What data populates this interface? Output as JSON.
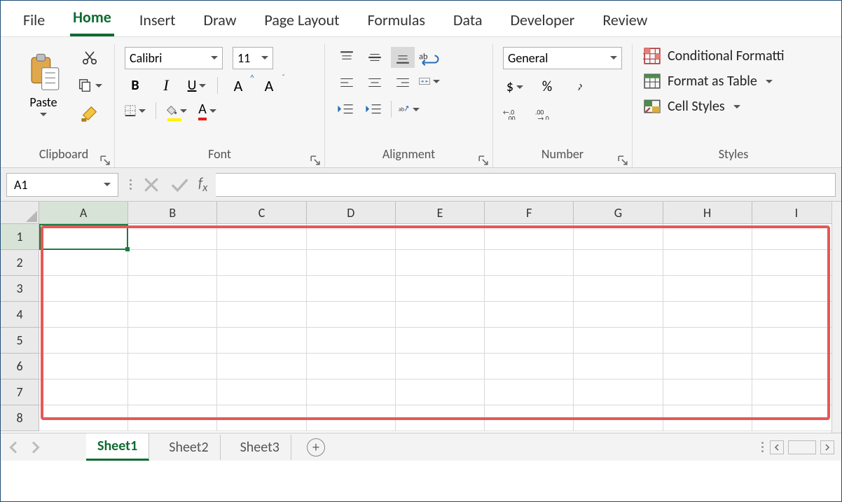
{
  "tabs": {
    "file": "File",
    "home": "Home",
    "insert": "Insert",
    "draw": "Draw",
    "pagelayout": "Page Layout",
    "formulas": "Formulas",
    "data": "Data",
    "developer": "Developer",
    "review": "Review",
    "active": "Home"
  },
  "ribbon": {
    "clipboard": {
      "paste": "Paste",
      "group": "Clipboard"
    },
    "font": {
      "name": "Calibri",
      "size": "11",
      "group": "Font"
    },
    "alignment": {
      "group": "Alignment"
    },
    "number": {
      "format": "General",
      "group": "Number"
    },
    "styles": {
      "conditional": "Conditional Formatti",
      "table": "Format as Table",
      "cell": "Cell Styles",
      "group": "Styles"
    }
  },
  "formula_bar": {
    "namebox": "A1",
    "formula": ""
  },
  "grid": {
    "columns": [
      "A",
      "B",
      "C",
      "D",
      "E",
      "F",
      "G",
      "H",
      "I"
    ],
    "rows": [
      "1",
      "2",
      "3",
      "4",
      "5",
      "6",
      "7",
      "8"
    ],
    "active_cell": "A1"
  },
  "sheets": {
    "items": [
      "Sheet1",
      "Sheet2",
      "Sheet3"
    ],
    "active": "Sheet1"
  }
}
